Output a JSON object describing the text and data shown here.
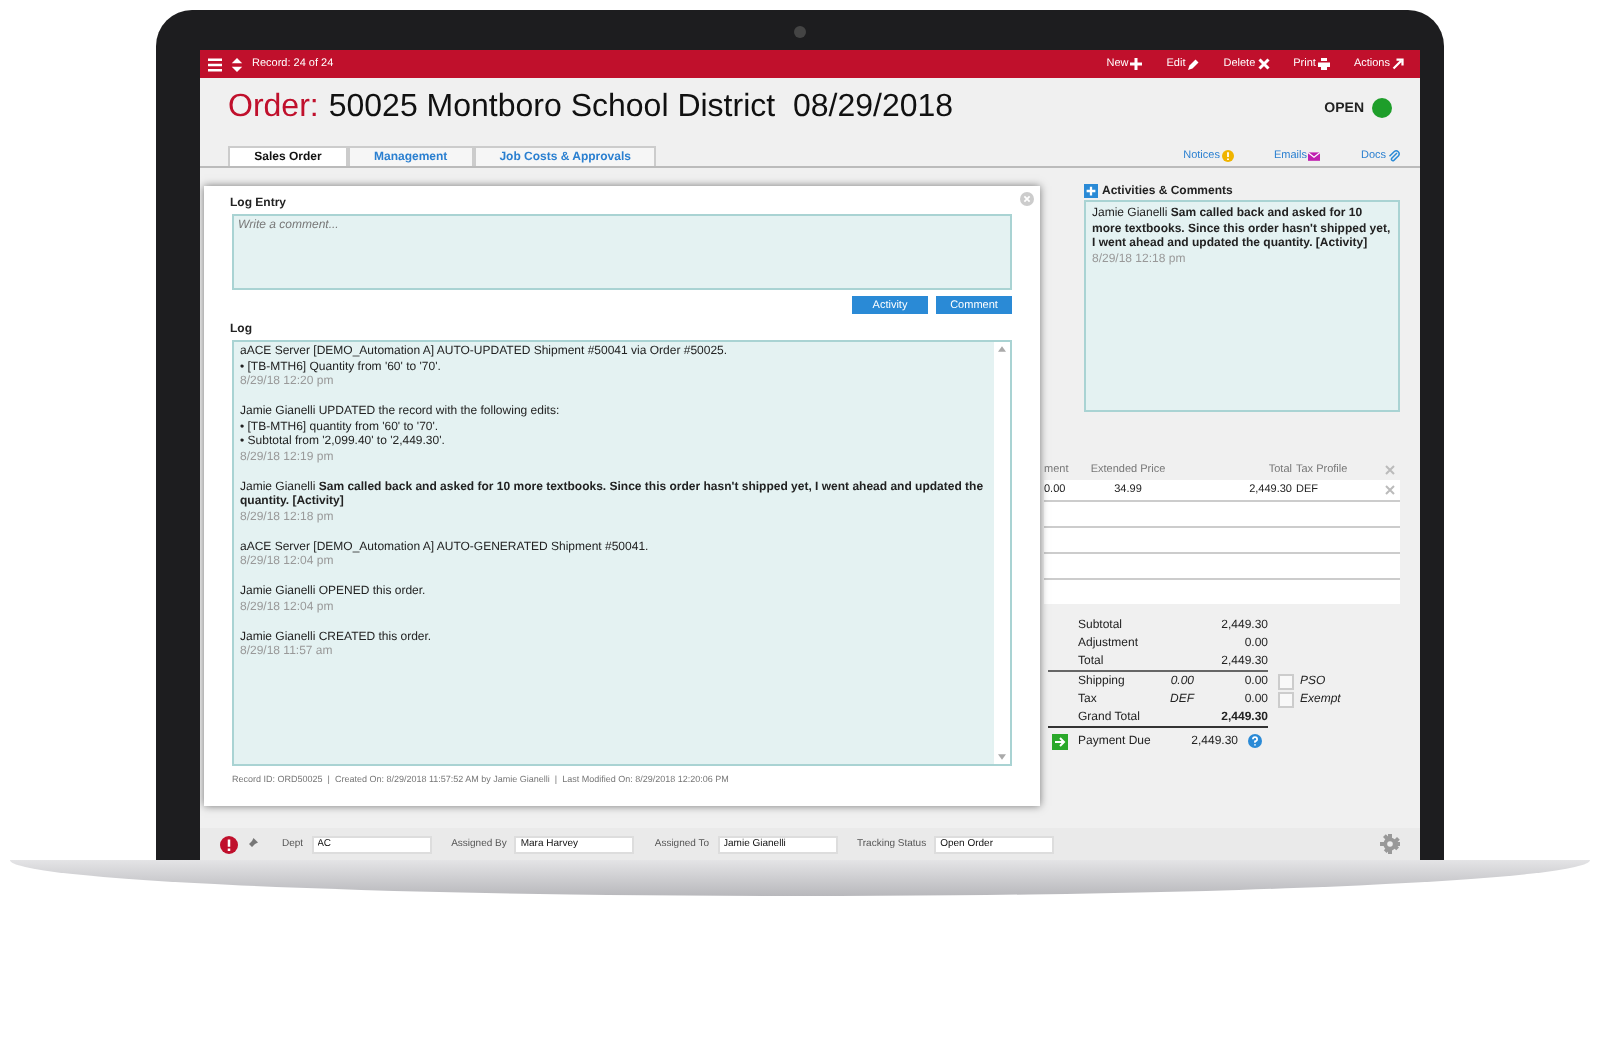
{
  "topbar": {
    "record": "Record: 24 of 24",
    "actions": [
      {
        "label": "New",
        "kind": "new"
      },
      {
        "label": "Edit",
        "kind": "edit"
      },
      {
        "label": "Delete",
        "kind": "delete"
      },
      {
        "label": "Print",
        "kind": "print"
      },
      {
        "label": "Actions",
        "kind": "actions"
      }
    ]
  },
  "header": {
    "label": "Order:",
    "title": "50025 Montboro School District  08/29/2018",
    "status": "OPEN",
    "color": "#1e9e2a"
  },
  "tabs": [
    {
      "label": "Sales Order",
      "selected": true
    },
    {
      "label": "Management",
      "selected": false
    },
    {
      "label": "Job Costs & Approvals",
      "selected": false
    }
  ],
  "links": [
    {
      "label": "Notices",
      "kind": "notices"
    },
    {
      "label": "Emails",
      "kind": "emails"
    },
    {
      "label": "Docs",
      "kind": "docs"
    }
  ],
  "modal": {
    "entry_label": "Log Entry",
    "placeholder": "Write a comment...",
    "buttons": [
      "Activity",
      "Comment"
    ],
    "log_label": "Log",
    "entries": [
      {
        "lines": [
          "aACE Server [DEMO_Automation A] AUTO-UPDATED Shipment #50041 via Order #50025.",
          "• [TB-MTH6] Quantity from '60' to '70'."
        ],
        "time": "8/29/18  12:20 pm"
      },
      {
        "lines": [
          "Jamie Gianelli UPDATED the record with the following edits:",
          "• [TB-MTH6] quantity from '60' to '70'.",
          "• Subtotal from '2,099.40' to '2,449.30'."
        ],
        "time": "8/29/18  12:19 pm"
      },
      {
        "lines": [
          "Jamie Gianelli **Sam called back and asked for 10 more textbooks. Since this order hasn't shipped yet, I went ahead and updated the quantity. [Activity]**"
        ],
        "time": "8/29/18  12:18 pm"
      },
      {
        "lines": [
          "aACE Server [DEMO_Automation A] AUTO-GENERATED Shipment #50041."
        ],
        "time": "8/29/18  12:04 pm"
      },
      {
        "lines": [
          "Jamie Gianelli OPENED this order."
        ],
        "time": "8/29/18  12:04 pm"
      },
      {
        "lines": [
          "Jamie Gianelli CREATED this order."
        ],
        "time": "8/29/18  11:57 am"
      }
    ],
    "footer": "Record ID: ORD50025  |  Created On: 8/29/2018 11:57:52 AM by Jamie Gianelli  |  Last Modified On: 8/29/2018 12:20:06 PM"
  },
  "activities": {
    "title": "Activities & Comments",
    "entries": [
      {
        "text": "Jamie Gianelli **Sam called back and asked for 10 more textbooks. Since this order hasn't shipped yet, I went ahead and updated the quantity. [Activity]**",
        "time": "8/29/18  12:18 pm"
      }
    ]
  },
  "table": {
    "columns": [
      "ment",
      "Extended Price",
      "Total",
      "Tax Profile"
    ],
    "rows": [
      [
        "0.00",
        "34.99",
        "2,449.30",
        "DEF"
      ]
    ]
  },
  "totals": [
    {
      "label": "Subtotal",
      "amount": "2,449.30"
    },
    {
      "label": "Adjustment",
      "amount": "0.00"
    },
    {
      "label": "Total",
      "amount": "2,449.30"
    }
  ],
  "charges": [
    {
      "label": "Shipping",
      "extra": "0.00",
      "amount": "0.00",
      "option": "PSO",
      "checked": false
    },
    {
      "label": "Tax",
      "extra": "DEF",
      "amount": "0.00",
      "option": "Exempt",
      "checked": false
    }
  ],
  "grand_total": {
    "label": "Grand Total",
    "amount": "2,449.30"
  },
  "payment_due": {
    "label": "Payment Due",
    "amount": "2,449.30"
  },
  "bottom_fields": [
    {
      "label": "Dept",
      "value": "AC"
    },
    {
      "label": "Assigned By",
      "value": "Mara Harvey"
    },
    {
      "label": "Assigned To",
      "value": "Jamie Gianelli"
    },
    {
      "label": "Tracking Status",
      "value": "Open Order"
    }
  ]
}
